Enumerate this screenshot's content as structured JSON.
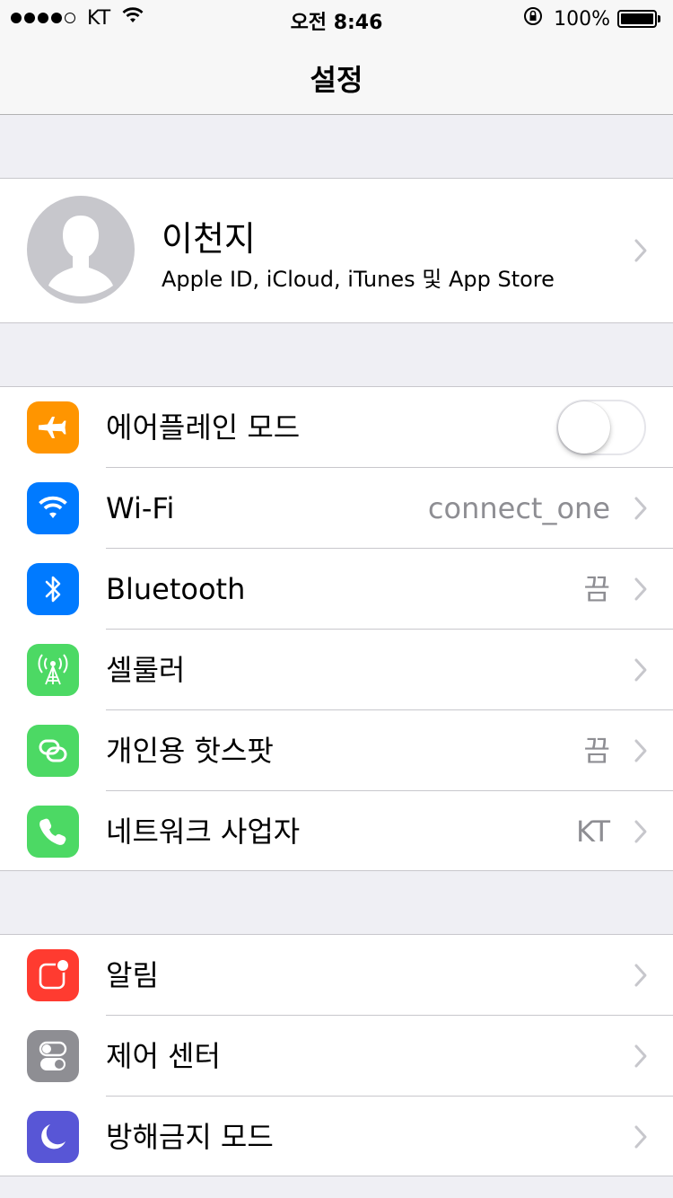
{
  "status_bar": {
    "carrier": "KT",
    "time": "오전 8:46",
    "battery_percent": "100%",
    "signal_bars_filled": 4,
    "signal_bars_total": 5
  },
  "nav": {
    "title": "설정"
  },
  "profile": {
    "name": "이천지",
    "subtitle": "Apple ID, iCloud, iTunes 및 App Store"
  },
  "connectivity": {
    "airplane": {
      "label": "에어플레인 모드",
      "on": false,
      "icon": "airplane-icon",
      "color": "#ff9500"
    },
    "wifi": {
      "label": "Wi-Fi",
      "value": "connect_one",
      "icon": "wifi-icon",
      "color": "#007aff"
    },
    "bluetooth": {
      "label": "Bluetooth",
      "value": "끔",
      "icon": "bluetooth-icon",
      "color": "#007aff"
    },
    "cellular": {
      "label": "셀룰러",
      "icon": "antenna-icon",
      "color": "#4cd964"
    },
    "hotspot": {
      "label": "개인용 핫스팟",
      "value": "끔",
      "icon": "link-icon",
      "color": "#4cd964"
    },
    "carrier": {
      "label": "네트워크 사업자",
      "value": "KT",
      "icon": "phone-icon",
      "color": "#4cd964"
    }
  },
  "system": {
    "notifications": {
      "label": "알림",
      "icon": "notification-icon",
      "color": "#ff3b30"
    },
    "control_center": {
      "label": "제어 센터",
      "icon": "switches-icon",
      "color": "#8e8e93"
    },
    "dnd": {
      "label": "방해금지 모드",
      "icon": "moon-icon",
      "color": "#5856d6"
    }
  }
}
